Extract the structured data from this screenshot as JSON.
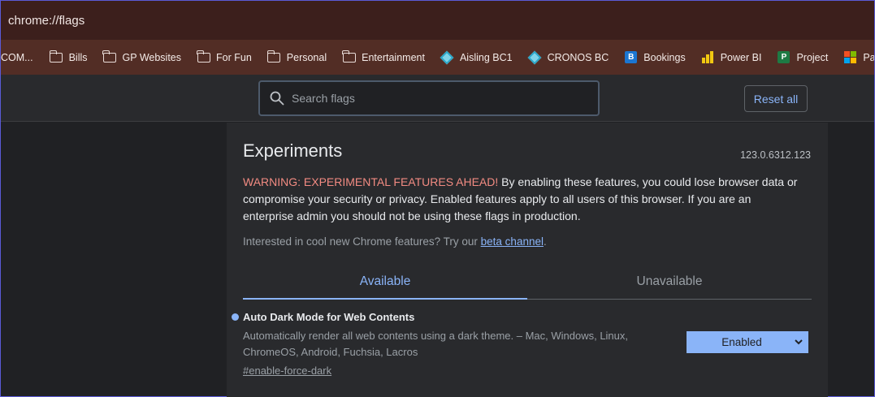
{
  "omnibox": {
    "url": "chrome://flags"
  },
  "bookmarks": [
    {
      "label": "COM...",
      "icon": "none"
    },
    {
      "label": "Bills",
      "icon": "folder-icon"
    },
    {
      "label": "GP Websites",
      "icon": "folder-icon"
    },
    {
      "label": "For Fun",
      "icon": "folder-icon"
    },
    {
      "label": "Personal",
      "icon": "folder-icon"
    },
    {
      "label": "Entertainment",
      "icon": "folder-icon"
    },
    {
      "label": "Aisling BC1",
      "icon": "business-central-icon"
    },
    {
      "label": "CRONOS BC",
      "icon": "business-central-icon"
    },
    {
      "label": "Bookings",
      "icon": "bookings-icon"
    },
    {
      "label": "Power BI",
      "icon": "power-bi-icon"
    },
    {
      "label": "Project",
      "icon": "project-icon"
    },
    {
      "label": "Partner",
      "icon": "microsoft-icon"
    }
  ],
  "header": {
    "search_placeholder": "Search flags",
    "reset_label": "Reset all"
  },
  "main": {
    "title": "Experiments",
    "version": "123.0.6312.123",
    "warning_prefix": "WARNING: EXPERIMENTAL FEATURES AHEAD!",
    "warning_body": " By enabling these features, you could lose browser data or compromise your security or privacy. Enabled features apply to all users of this browser. If you are an enterprise admin you should not be using these flags in production.",
    "interest_text": "Interested in cool new Chrome features? Try our ",
    "interest_link": "beta channel",
    "interest_end": ".",
    "tabs": [
      {
        "label": "Available",
        "active": true
      },
      {
        "label": "Unavailable",
        "active": false
      }
    ]
  },
  "flag": {
    "name": "Auto Dark Mode for Web Contents",
    "description": "Automatically render all web contents using a dark theme. – Mac, Windows, Linux, ChromeOS, Android, Fuchsia, Lacros",
    "link": "#enable-force-dark",
    "value": "Enabled"
  },
  "colors": {
    "accent": "#8ab4f8",
    "warning": "#f28b82",
    "frame": "#3c1f1c",
    "bookmark_bar": "#522d25"
  }
}
